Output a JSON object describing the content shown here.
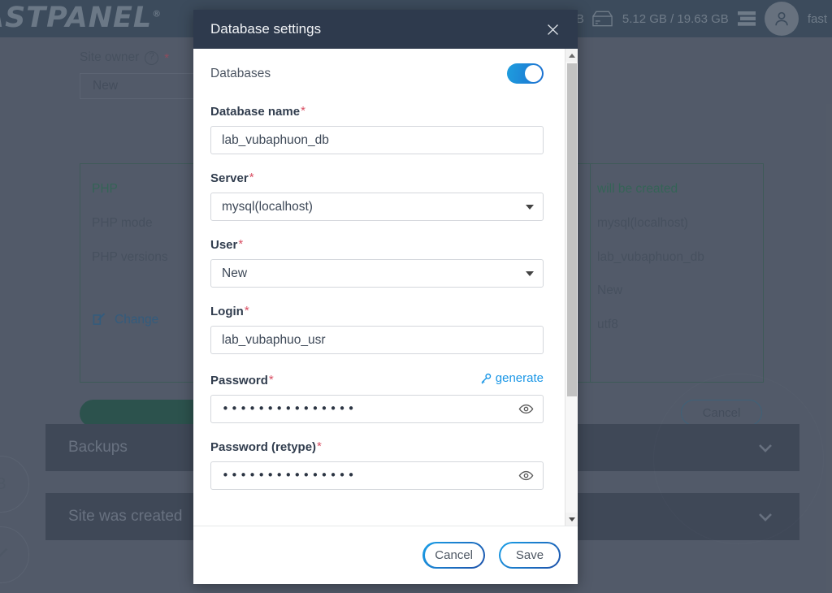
{
  "background": {
    "brand": "ASTPANEL",
    "brand_sup": "®",
    "header": {
      "gb_label": "GB",
      "disk_icon": "disk-icon",
      "disk_usage": "5.12 GB / 19.63 GB",
      "server_icon": "server-icon",
      "avatar_icon": "user-avatar-icon",
      "username": "fast"
    },
    "site_owner": {
      "label": "Site owner",
      "help_icon": "question-mark-icon",
      "required": "*",
      "value": "New"
    },
    "summary_card": {
      "left_column": [
        "PHP",
        "PHP mode",
        "PHP versions"
      ],
      "right_column": [
        "will be created",
        "mysql(localhost)",
        "lab_vubaphuon_db",
        "New",
        "utf8"
      ],
      "change_link": "Change",
      "change_icon": "edit-pencil-icon"
    },
    "cancel_button": "Cancel",
    "accordions": [
      {
        "label": "Backups",
        "chevron": "chevron-down-icon"
      },
      {
        "label": "Site was created",
        "chevron": "chevron-down-icon"
      }
    ],
    "badges": [
      "B",
      "check-circle-icon"
    ]
  },
  "modal": {
    "title": "Database settings",
    "close_icon": "close-icon",
    "toggle": {
      "label": "Databases",
      "state": "on"
    },
    "fields": [
      {
        "key": "database_name",
        "label": "Database name",
        "required": "*",
        "type": "text",
        "value": "lab_vubaphuon_db"
      },
      {
        "key": "server",
        "label": "Server",
        "required": "*",
        "type": "select",
        "value": "mysql(localhost)",
        "caret_icon": "chevron-down-icon"
      },
      {
        "key": "user",
        "label": "User",
        "required": "*",
        "type": "select",
        "value": "New",
        "caret_icon": "chevron-down-icon"
      },
      {
        "key": "login",
        "label": "Login",
        "required": "*",
        "type": "text",
        "value": "lab_vubaphuo_usr"
      },
      {
        "key": "password",
        "label": "Password",
        "required": "*",
        "type": "password",
        "value": "•••••••••••••••",
        "action_label": "generate",
        "action_icon": "key-icon",
        "reveal_icon": "eye-icon"
      },
      {
        "key": "password_retype",
        "label": "Password (retype)",
        "required": "*",
        "type": "password",
        "value": "•••••••••••••••",
        "reveal_icon": "eye-icon"
      }
    ],
    "scrollbar": {
      "up_icon": "scroll-up-arrow-icon",
      "down_icon": "scroll-down-arrow-icon"
    },
    "footer": {
      "cancel_label": "Cancel",
      "save_label": "Save"
    }
  },
  "colors": {
    "modal_header_bg": "#2e3a4d",
    "accent_blue": "#1996e6",
    "toggle_on": "#1b6fd0",
    "required_red": "#d94f63",
    "green_text": "#2e7d58",
    "page_header_bg": "#3b5062"
  }
}
